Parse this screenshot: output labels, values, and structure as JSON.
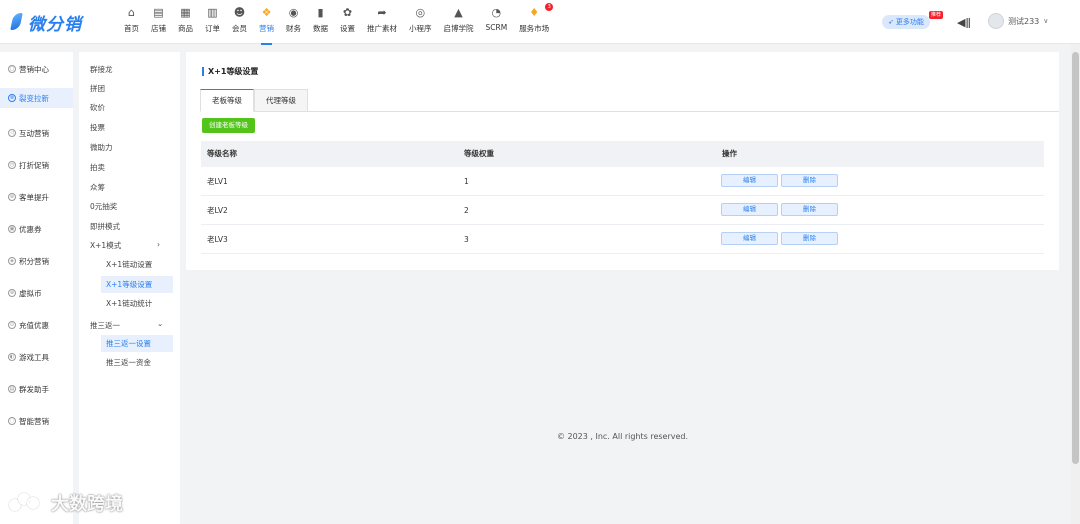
{
  "app": {
    "logo_text": "微分销",
    "brand_color": "#2a7ff0"
  },
  "topnav": [
    {
      "label": "首页",
      "icon": "home-icon",
      "glyph": "⌂"
    },
    {
      "label": "店铺",
      "icon": "store-icon",
      "glyph": "▤"
    },
    {
      "label": "商品",
      "icon": "goods-icon",
      "glyph": "▦"
    },
    {
      "label": "订单",
      "icon": "order-icon",
      "glyph": "▥"
    },
    {
      "label": "会员",
      "icon": "member-icon",
      "glyph": "☻"
    },
    {
      "label": "营销",
      "icon": "marketing-icon",
      "glyph": "❖",
      "active": true
    },
    {
      "label": "财务",
      "icon": "finance-icon",
      "glyph": "◉"
    },
    {
      "label": "数据",
      "icon": "data-icon",
      "glyph": "▮"
    },
    {
      "label": "设置",
      "icon": "settings-icon",
      "glyph": "✿"
    },
    {
      "label": "推广素材",
      "icon": "share-icon",
      "glyph": "➦"
    },
    {
      "label": "小程序",
      "icon": "miniapp-icon",
      "glyph": "◎"
    },
    {
      "label": "启博学院",
      "icon": "academy-icon",
      "glyph": "▲"
    },
    {
      "label": "SCRM",
      "icon": "scrm-icon",
      "glyph": "◔"
    },
    {
      "label": "服务市场",
      "icon": "service-market-icon",
      "glyph": "♦",
      "badge": "3"
    }
  ],
  "header_right": {
    "more_label": "更多功能",
    "hot_label": "推荐",
    "username": "测试233"
  },
  "side1": [
    {
      "label": "营销中心"
    },
    {
      "label": "裂变拉新",
      "active": true
    },
    {
      "label": "互动营销"
    },
    {
      "label": "打折促销"
    },
    {
      "label": "客单提升"
    },
    {
      "label": "优惠券"
    },
    {
      "label": "积分营销"
    },
    {
      "label": "虚拟币"
    },
    {
      "label": "充值优惠"
    },
    {
      "label": "游戏工具"
    },
    {
      "label": "群发助手"
    },
    {
      "label": "智能营销"
    }
  ],
  "side2": {
    "items": [
      "群接龙",
      "拼团",
      "砍价",
      "投票",
      "微助力",
      "拍卖",
      "众筹",
      "0元抽奖",
      "即拼模式"
    ],
    "group1": {
      "label": "X+1模式",
      "subs": [
        "X+1链动设置",
        "X+1等级设置",
        "X+1链动统计"
      ]
    },
    "group2": {
      "label": "推三返一",
      "subs": [
        "推三返一设置",
        "推三返一资金"
      ]
    }
  },
  "main": {
    "title": "X+1等级设置",
    "tabs": [
      "老板等级",
      "代理等级"
    ],
    "create_label": "创建老板等级",
    "columns": [
      "等级名称",
      "等级权重",
      "操作"
    ],
    "rows": [
      {
        "name": "老LV1",
        "weight": "1"
      },
      {
        "name": "老LV2",
        "weight": "2"
      },
      {
        "name": "老LV3",
        "weight": "3"
      }
    ],
    "edit_label": "编辑",
    "delete_label": "删除"
  },
  "footer": "© 2023 , Inc. All rights reserved.",
  "watermark": "大数跨境"
}
